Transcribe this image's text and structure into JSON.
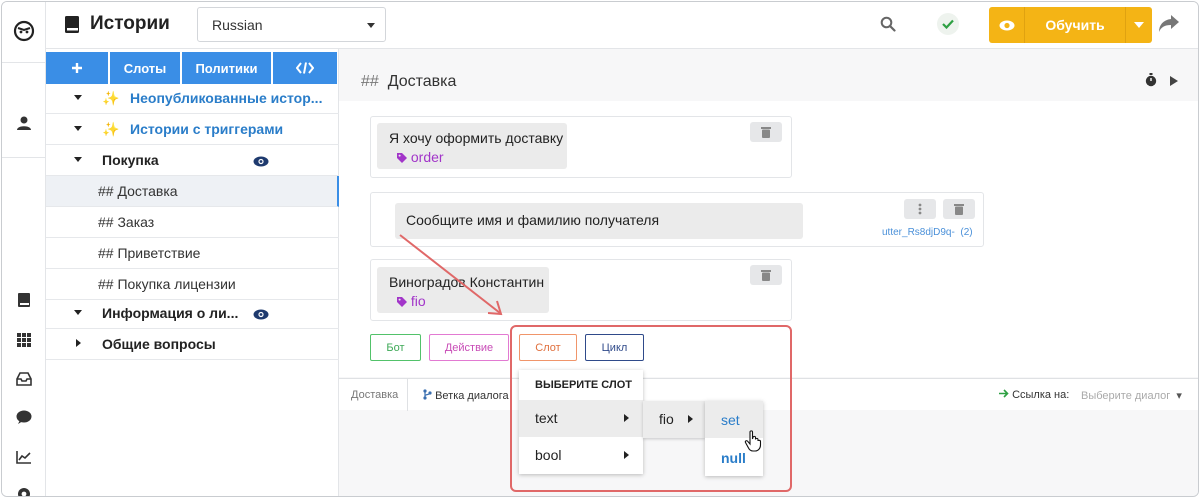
{
  "app": {
    "title": "Истории",
    "language": "Russian",
    "train_label": "Обучить"
  },
  "sidebar": {
    "tabs": [
      {
        "label": "+",
        "icon": "plus-icon"
      },
      {
        "label": "Слоты"
      },
      {
        "label": "Политики"
      },
      {
        "label": "</>",
        "icon": "code-icon"
      }
    ],
    "items": [
      {
        "label": "Неопубликованные истор...",
        "icon": "sparkles-icon"
      },
      {
        "label": "Истории с триггерами",
        "icon": "sparkles-icon"
      },
      {
        "label": "Покупка"
      },
      {
        "label": "## Доставка"
      },
      {
        "label": "## Заказ"
      },
      {
        "label": "## Приветствие"
      },
      {
        "label": "## Покупка лицензии"
      },
      {
        "label": "Информация о ли..."
      },
      {
        "label": "Общие вопросы"
      }
    ]
  },
  "story": {
    "header": "Доставка",
    "header_prefix": "##",
    "user_message_1": {
      "text": "Я хочу оформить доставку",
      "intent": "order"
    },
    "bot_message": {
      "text": "Сообщите имя и фамилию получателя",
      "utter": "utter_Rs8djD9q-",
      "count": "(2)"
    },
    "user_message_2": {
      "text": "Виноградов Константин",
      "intent": "fio"
    },
    "add_buttons": {
      "bot": "Бот",
      "action": "Действие",
      "slot": "Слот",
      "loop": "Цикл"
    },
    "colors": {
      "bot": "#52c26a",
      "action": "#e27ad2",
      "slot": "#f0956a",
      "loop": "#2f4a8a"
    }
  },
  "footer": {
    "crumb": "Доставка",
    "branch": "Ветка диалога",
    "link_label": "Ссылка на:",
    "link_placeholder": "Выберите диалог"
  },
  "slot_menu": {
    "header": "ВЫБЕРИТЕ СЛОТ",
    "types": [
      "text",
      "bool"
    ],
    "slot_name": "fio",
    "values": [
      "set",
      "null"
    ]
  }
}
